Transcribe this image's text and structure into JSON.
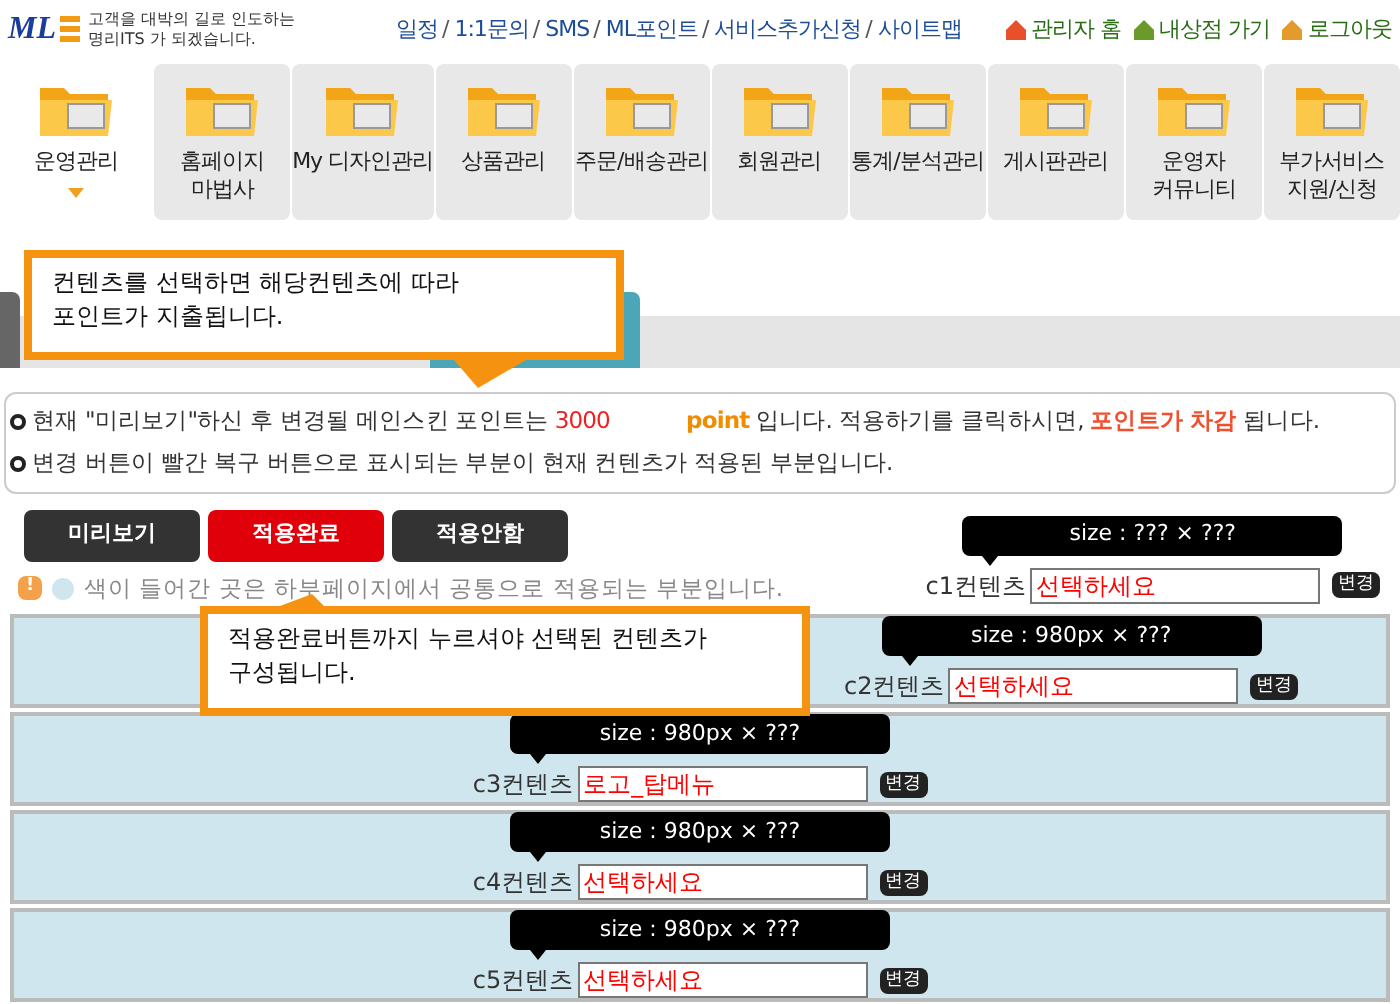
{
  "header": {
    "slogan_lines": [
      "고객을 대박의 길로 인도하는",
      "명리ITS 가 되겠습니다."
    ],
    "logo_text": "ML",
    "links": [
      "일정",
      "1:1문의",
      "SMS",
      "ML포인트",
      "서비스추가신청",
      "사이트맵"
    ],
    "separator": "/",
    "quick_links": [
      {
        "label": "관리자 홈",
        "kind": "home"
      },
      {
        "label": "내상점 가기",
        "kind": "shop"
      },
      {
        "label": "로그아웃",
        "kind": "logout"
      }
    ]
  },
  "nav": [
    {
      "label": "운영관리",
      "selected": true
    },
    {
      "label": "홈페이지\n마법사",
      "selected": false
    },
    {
      "label": "My 디자인관리",
      "selected": false
    },
    {
      "label": "상품관리",
      "selected": false
    },
    {
      "label": "주문/배송관리",
      "selected": false
    },
    {
      "label": "회원관리",
      "selected": false
    },
    {
      "label": "통계/분석관리",
      "selected": false
    },
    {
      "label": "게시판관리",
      "selected": false
    },
    {
      "label": "운영자\n커뮤니티",
      "selected": false
    },
    {
      "label": "부가서비스\n지원/신청",
      "selected": false
    }
  ],
  "callouts": [
    {
      "text": "컨텐츠를 선택하면 해당컨텐츠에 따라\n포인트가 지출됩니다.",
      "kind": "down"
    },
    {
      "text": "적용완료버튼까지 누르셔야 선택된 컨텐츠가\n구성됩니다.",
      "kind": "up"
    }
  ],
  "info_lines": [
    [
      {
        "text": "현재 \"미리보기\"하신 후 변경될 메인스킨 포인트는 ",
        "kind": "normal"
      },
      {
        "text": "3000",
        "kind": "red"
      },
      {
        "text": "point",
        "kind": "orange"
      },
      {
        "text": " 입니다. 적용하기를 클릭하시면, ",
        "kind": "normal"
      },
      {
        "text": "포인트가 차감",
        "kind": "redbold"
      },
      {
        "text": " 됩니다.",
        "kind": "normal"
      }
    ],
    [
      {
        "text": "변경 버튼이 빨간 복구 버튼으로 표시되는 부분이 현재 컨텐츠가 적용된 부분입니다.",
        "kind": "normal"
      }
    ]
  ],
  "buttons": [
    {
      "label": "미리보기",
      "selected": false
    },
    {
      "label": "적용완료",
      "selected": true
    },
    {
      "label": "적용안함",
      "selected": false
    }
  ],
  "notice": {
    "icon": "!",
    "text": "색이 들어간 곳은 하부페이지에서 공통으로 적용되는 부분입니다."
  },
  "slots": [
    {
      "size": "size : ??? × ???",
      "label": "c1컨텐츠",
      "value": "선택하세요",
      "button": "변경",
      "shared": false
    },
    {
      "size": "size : 980px × ???",
      "label": "c2컨텐츠",
      "value": "선택하세요",
      "button": "변경",
      "shared": true
    },
    {
      "size": "size : 980px × ???",
      "label": "c3컨텐츠",
      "value": "로고_탑메뉴",
      "button": "변경",
      "shared": true
    },
    {
      "size": "size : 980px × ???",
      "label": "c4컨텐츠",
      "value": "선택하세요",
      "button": "변경",
      "shared": true
    },
    {
      "size": "size : 980px × ???",
      "label": "c5컨텐츠",
      "value": "선택하세요",
      "button": "변경",
      "shared": true
    }
  ]
}
